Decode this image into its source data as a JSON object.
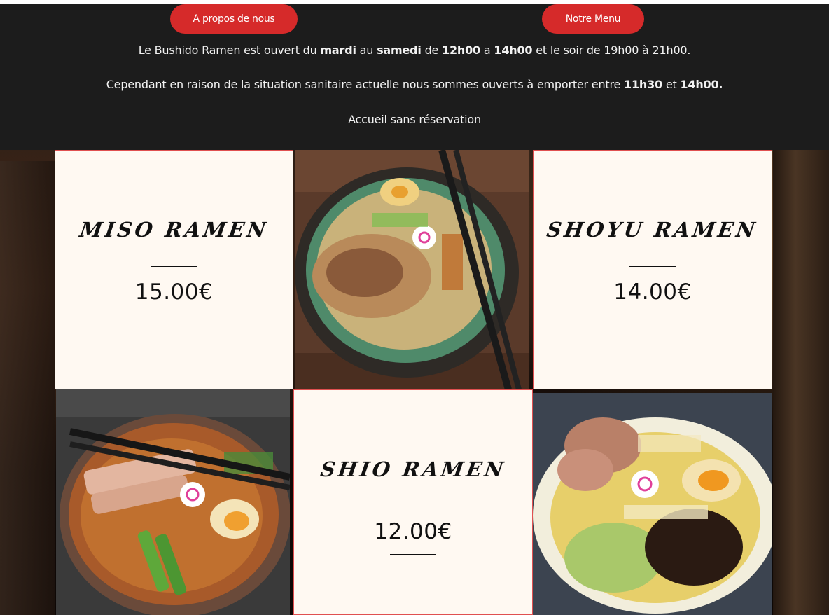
{
  "nav": {
    "about_label": "A propos de nous",
    "menu_label": "Notre Menu"
  },
  "info": {
    "line1": [
      {
        "t": "Le Bushido Ramen est ouvert du ",
        "b": false
      },
      {
        "t": "mardi",
        "b": true
      },
      {
        "t": " au ",
        "b": false
      },
      {
        "t": "samedi",
        "b": true
      },
      {
        "t": " de ",
        "b": false
      },
      {
        "t": "12h00",
        "b": true
      },
      {
        "t": " a ",
        "b": false
      },
      {
        "t": "14h00",
        "b": true
      },
      {
        "t": " et le soir de 19h00 à 21h00.",
        "b": false
      }
    ],
    "line2": [
      {
        "t": "Cependant en raison de la situation sanitaire actuelle nous sommes ouverts à emporter entre ",
        "b": false
      },
      {
        "t": "11h30",
        "b": true
      },
      {
        "t": " et ",
        "b": false
      },
      {
        "t": "14h00.",
        "b": true
      }
    ],
    "line3": "Accueil sans réservation"
  },
  "menu": [
    {
      "name": "Miso Ramen",
      "price": "15.00€"
    },
    {
      "name": "Shoyu Ramen",
      "price": "14.00€"
    },
    {
      "name": "Shio Ramen",
      "price": "12.00€"
    }
  ],
  "colors": {
    "accent": "#d62a2a",
    "header_bg": "#1c1c1c",
    "card_bg": "#fff9f2",
    "card_border": "#e05050"
  },
  "icons": {
    "photo1": "miso-ramen-photo",
    "photo2": "shoyu-ramen-photo",
    "photo3": "shio-ramen-photo"
  }
}
